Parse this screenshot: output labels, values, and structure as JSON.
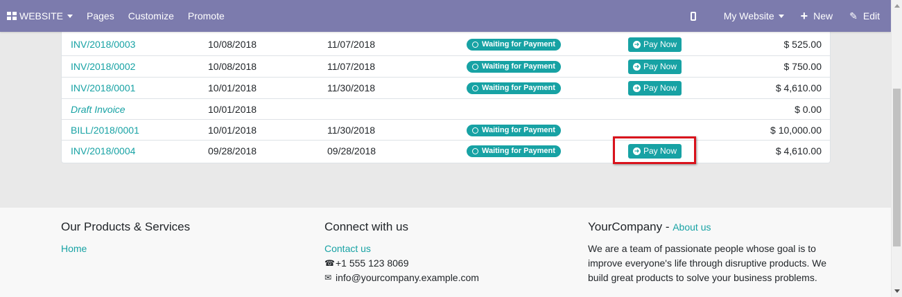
{
  "topbar": {
    "brand": "WEBSITE",
    "menu": [
      "Pages",
      "Customize",
      "Promote"
    ],
    "website_label": "My Website",
    "new_label": "New",
    "edit_label": "Edit"
  },
  "invoices": [
    {
      "name": "INV/2018/0003",
      "date": "10/08/2018",
      "due": "11/07/2018",
      "status": "Waiting for Payment",
      "pay": "Pay Now",
      "amount": "$ 525.00"
    },
    {
      "name": "INV/2018/0002",
      "date": "10/08/2018",
      "due": "11/07/2018",
      "status": "Waiting for Payment",
      "pay": "Pay Now",
      "amount": "$ 750.00"
    },
    {
      "name": "INV/2018/0001",
      "date": "10/01/2018",
      "due": "11/30/2018",
      "status": "Waiting for Payment",
      "pay": "Pay Now",
      "amount": "$ 4,610.00"
    },
    {
      "name": "Draft Invoice",
      "date": "10/01/2018",
      "due": "",
      "status": "",
      "pay": "",
      "amount": "$ 0.00"
    },
    {
      "name": "BILL/2018/0001",
      "date": "10/01/2018",
      "due": "11/30/2018",
      "status": "Waiting for Payment",
      "pay": "",
      "amount": "$ 10,000.00"
    },
    {
      "name": "INV/2018/0004",
      "date": "09/28/2018",
      "due": "09/28/2018",
      "status": "Waiting for Payment",
      "pay": "Pay Now",
      "amount": "$ 4,610.00"
    }
  ],
  "footer": {
    "col1_title": "Our Products & Services",
    "col1_link": "Home",
    "col2_title": "Connect with us",
    "col2_link": "Contact us",
    "phone": "+1 555 123 8069",
    "email": "info@yourcompany.example.com",
    "col3_title": "YourCompany",
    "col3_sep": " - ",
    "col3_link": "About us",
    "col3_text": "We are a team of passionate people whose goal is to improve everyone's life through disruptive products. We build great products to solve your business problems."
  },
  "colors": {
    "accent": "#17a2a4",
    "topbar": "#7c7bad",
    "highlight": "#d9121c"
  }
}
